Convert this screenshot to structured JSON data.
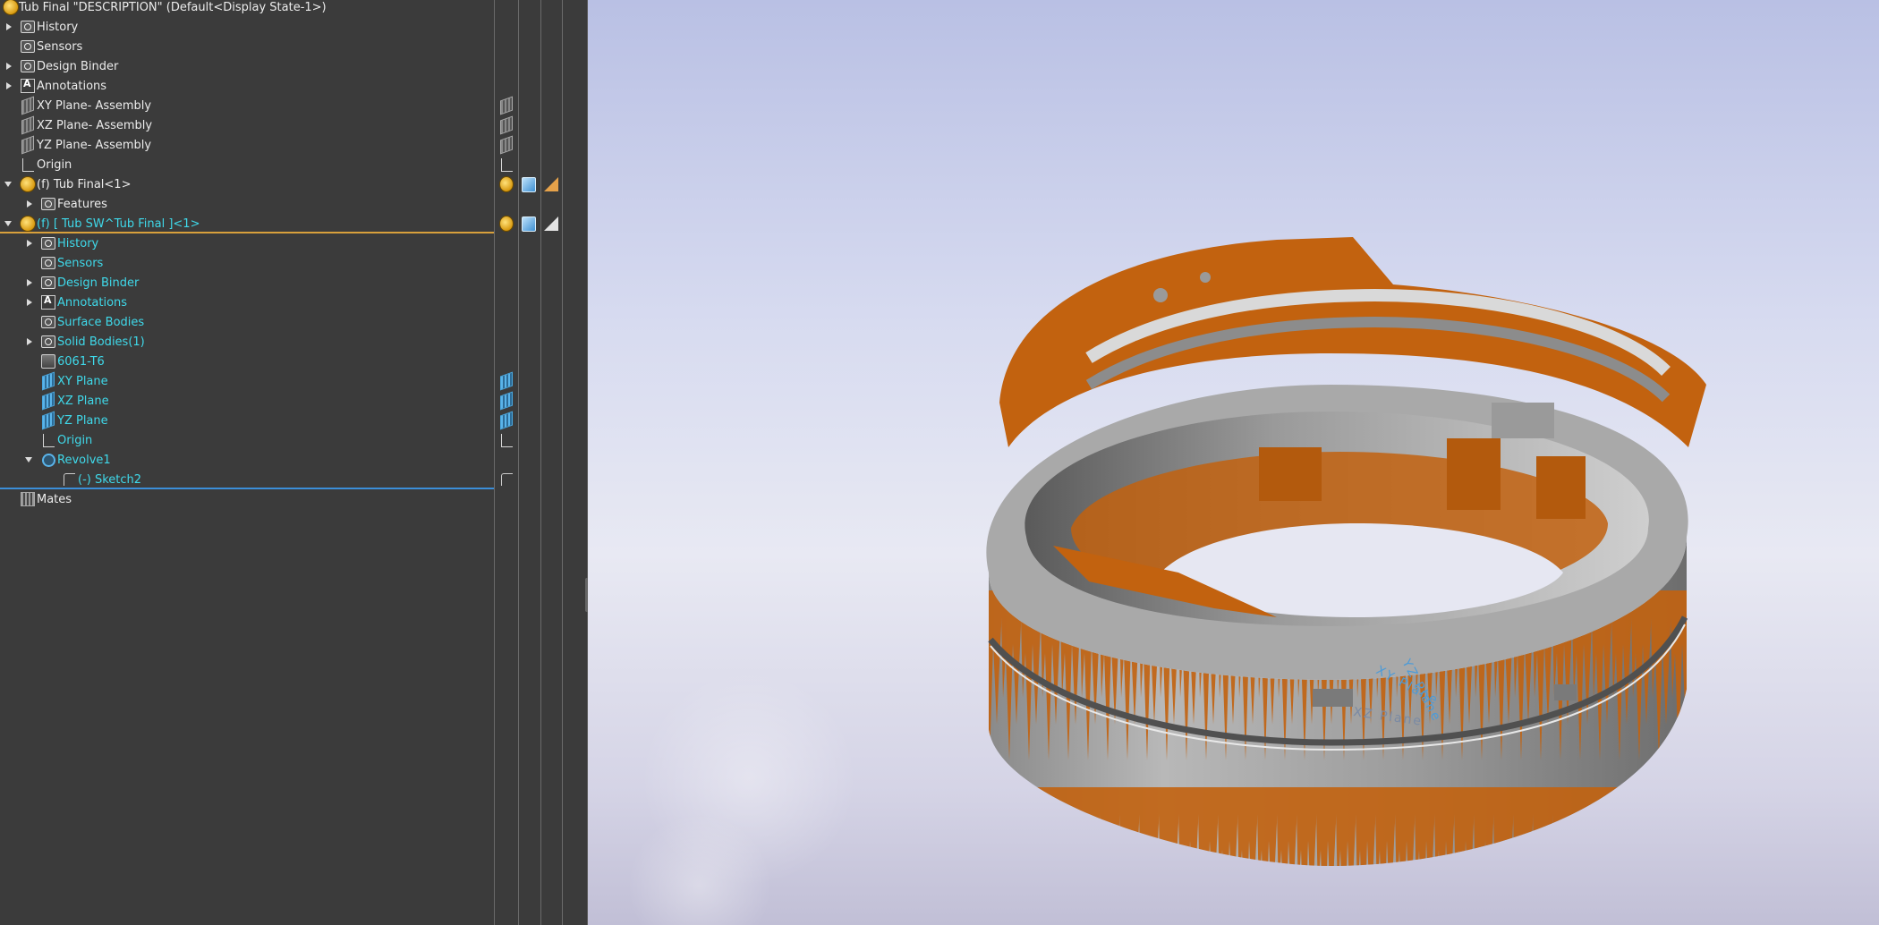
{
  "tree": {
    "root_title": "Tub Final \"DESCRIPTION\"  (Default<Display State-1>)",
    "items": [
      {
        "label": "History",
        "icon": "history-folder-icon"
      },
      {
        "label": "Sensors",
        "icon": "sensor-folder-icon"
      },
      {
        "label": "Design Binder",
        "icon": "binder-folder-icon"
      },
      {
        "label": "Annotations",
        "icon": "annotations-icon"
      },
      {
        "label": "XY Plane- Assembly",
        "icon": "plane-icon"
      },
      {
        "label": "XZ Plane- Assembly",
        "icon": "plane-icon"
      },
      {
        "label": "YZ Plane- Assembly",
        "icon": "plane-icon"
      },
      {
        "label": "Origin",
        "icon": "origin-icon"
      },
      {
        "label": "(f) Tub Final<1>",
        "icon": "part-icon"
      },
      {
        "label": "Features",
        "icon": "folder-icon"
      },
      {
        "label": "(f) [ Tub SW^Tub Final ]<1>",
        "icon": "part-icon"
      },
      {
        "label": "History",
        "icon": "history-folder-icon"
      },
      {
        "label": "Sensors",
        "icon": "sensor-folder-icon"
      },
      {
        "label": "Design Binder",
        "icon": "binder-folder-icon"
      },
      {
        "label": "Annotations",
        "icon": "annotations-icon"
      },
      {
        "label": "Surface Bodies",
        "icon": "surface-bodies-icon"
      },
      {
        "label": "Solid Bodies(1)",
        "icon": "solid-bodies-icon"
      },
      {
        "label": "6061-T6",
        "icon": "material-icon"
      },
      {
        "label": "XY  Plane",
        "icon": "plane-icon"
      },
      {
        "label": "XZ  Plane",
        "icon": "plane-icon"
      },
      {
        "label": "YZ Plane",
        "icon": "plane-icon"
      },
      {
        "label": "Origin",
        "icon": "origin-icon"
      },
      {
        "label": "Revolve1",
        "icon": "revolve-icon"
      },
      {
        "label": "(-) Sketch2",
        "icon": "sketch-icon"
      },
      {
        "label": "Mates",
        "icon": "mates-icon"
      }
    ]
  },
  "viewport": {
    "plane_labels": {
      "yz": "YZ Plane",
      "xy": "XY Plane",
      "xz": "XZ Plane"
    }
  },
  "colors": {
    "tree_bg": "#3b3b3b",
    "tree_text": "#ececec",
    "child_text": "#3fd9ea",
    "orange_rule": "#d8a03c",
    "blue_rule": "#3b8ed8",
    "model_orange": "#c2620f",
    "model_grey": "#9a9a9a"
  }
}
